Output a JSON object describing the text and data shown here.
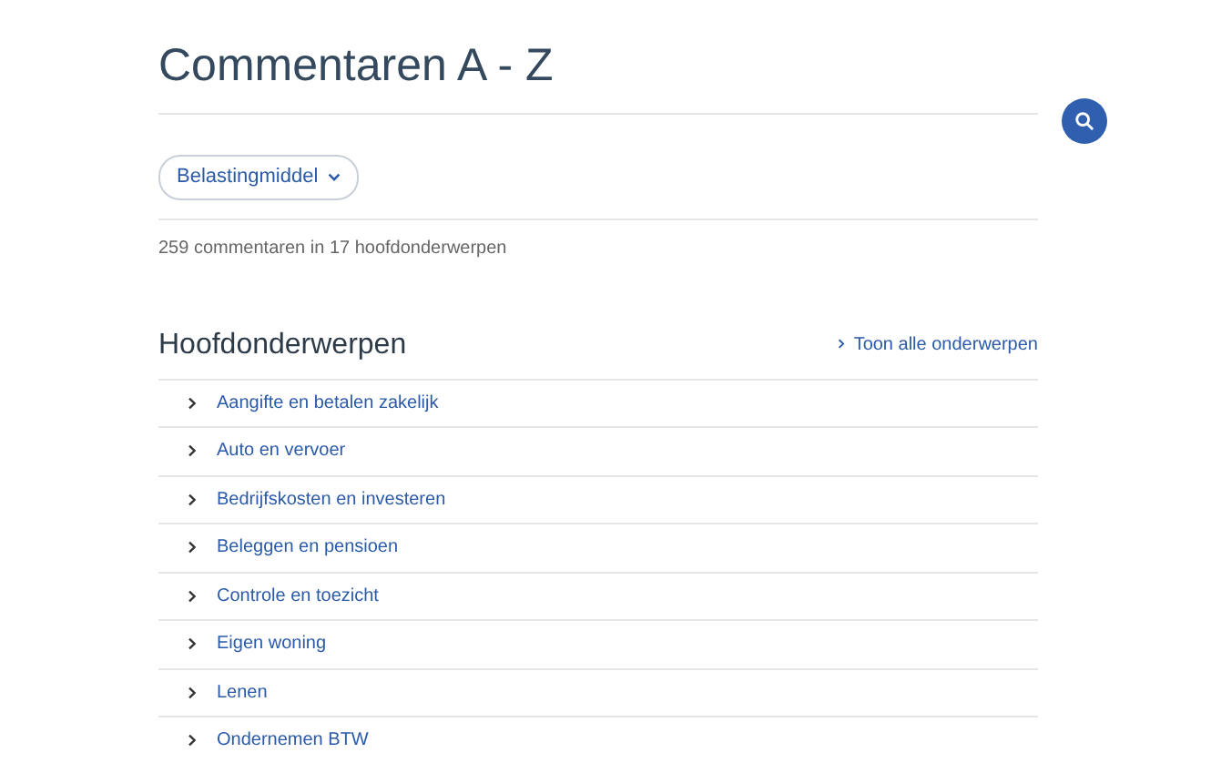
{
  "page_title": "Commentaren A - Z",
  "filter": {
    "label": "Belastingmiddel"
  },
  "summary": "259 commentaren in 17 hoofdonderwerpen",
  "section": {
    "title": "Hoofdonderwerpen",
    "link": "Toon alle onderwerpen",
    "items": [
      "Aangifte en betalen zakelijk",
      "Auto en vervoer",
      "Bedrijfskosten en investeren",
      "Beleggen en pensioen",
      "Controle en toezicht",
      "Eigen woning",
      "Lenen",
      "Ondernemen BTW"
    ]
  }
}
